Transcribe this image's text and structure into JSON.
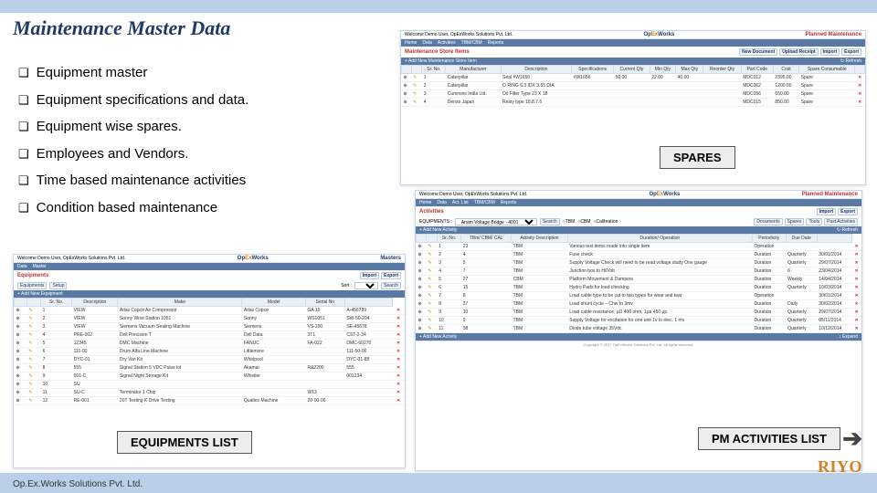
{
  "slide": {
    "title": "Maintenance Master Data",
    "footer": "Op.Ex.Works Solutions Pvt. Ltd.",
    "brand": "RIYO"
  },
  "bullets": [
    "Equipment master",
    "Equipment specifications and data.",
    "Equipment wise spares.",
    "Employees and Vendors.",
    "Time based maintenance activities",
    "Condition based maintenance"
  ],
  "labels": {
    "spares": "SPARES",
    "equip": "EQUIPMENTS LIST",
    "pm": "PM ACTIVITIES LIST"
  },
  "app": {
    "welcome": "Welcome Demo User, OpExWorks Solutions Pvt. Ltd.",
    "logo_a": "Op",
    "logo_b": "Ex",
    "logo_c": "Works",
    "pm_label": "Planned Maintenance",
    "masters_label": "Masters",
    "nav": [
      "Home",
      "Data",
      "Activities",
      "TBM/CBM",
      "Reports"
    ],
    "nav2": [
      "Data",
      "Master"
    ],
    "nav3": [
      "Home",
      "Data",
      "Act. List",
      "TBM/CBM",
      "Reports"
    ],
    "copyright": "Copyright © 2017 OpExWorks Solutions Pvt. Ltd. All rights reserved."
  },
  "spares": {
    "heading": "Maintenance Store Items",
    "buttons": [
      "New Document",
      "Upload Receipt",
      "Import",
      "Export"
    ],
    "bar_add": "+ Add New Maintenance Store Item",
    "refresh": "↻ Refresh",
    "cols": [
      "",
      "",
      "Sr. No.",
      "Manufacturer",
      "Description",
      "Specifications",
      "Current Qty",
      "Min Qty",
      "Max Qty",
      "Reorder Qty",
      "Part Code",
      "Cost",
      "Spare Consumable",
      ""
    ],
    "rows": [
      [
        "1",
        "Caterpillar",
        "Seal #W1656",
        "#W1656",
        "50.00",
        "22.00",
        "40.00",
        "",
        "MDC012",
        "2395.00",
        "Spare"
      ],
      [
        "2",
        "Caterpillar",
        "O RING 6.3 IDX 3.55 DIA",
        "",
        "",
        "",
        "",
        "",
        "MDC062",
        "1200.00",
        "Spare"
      ],
      [
        "3",
        "Cummins India Ltd.",
        "Oil Filter Type 23 X 18",
        "",
        "",
        "",
        "",
        "",
        "MDC056",
        "650.00",
        "Spare"
      ],
      [
        "4",
        "Denso Japan",
        "Relay type 18.8.7.6",
        "",
        "",
        "",
        "",
        "",
        "MDC015",
        "850.00",
        "Spare"
      ]
    ]
  },
  "equip": {
    "heading": "Equipments",
    "tabs": [
      "Equipments",
      "Setup"
    ],
    "sort": "Sort :",
    "buttons": [
      "Import",
      "Export"
    ],
    "search": "Search",
    "bar_add": "+ Add New Equipment",
    "cols": [
      "",
      "",
      "Sr. No.",
      "Description",
      "Make",
      "Model",
      "Serial No",
      ""
    ],
    "rows": [
      [
        "1",
        "VIEW",
        "Atlas Copco Air Compressor",
        "Atlas Copco",
        "GA 15",
        "A-456789"
      ],
      [
        "2",
        "VIEW",
        "Sunny Wrist Station 1051",
        "Sunny",
        "WS1051",
        "SW-50-204"
      ],
      [
        "3",
        "VIEW",
        "Siemens Vacuum Sealing Machine",
        "Siemens",
        "VS-200",
        "SE-45678"
      ],
      [
        "4",
        "PRE-002",
        "Dell Precision T",
        "Dell Data",
        "3T1",
        "CST-2-34"
      ],
      [
        "5",
        "12345",
        "DMC Machine",
        "FANUC",
        "FA-022",
        "DMC-60270"
      ],
      [
        "6",
        "111-00",
        "Drum Alfa Line Machine",
        "Littlemore",
        "",
        "111-50-00"
      ],
      [
        "7",
        "DYC-01",
        "Dry Van Kit",
        "Whirlpool",
        "",
        "DYC-01-88"
      ],
      [
        "8",
        "555",
        "Signal Station 5 VDC Pulse kit",
        "Akamai",
        "R&2200",
        "555"
      ],
      [
        "9",
        "001-C",
        "Signal Night Storage Kit",
        "Whistler",
        "",
        "001234"
      ],
      [
        "10",
        "SU",
        "",
        "",
        "",
        ""
      ],
      [
        "11",
        "SU-C",
        "Terminator 1 Chip",
        "",
        "W13",
        ""
      ],
      [
        "12",
        "RE-001",
        "20T Testing K Drive Testing",
        "Qualtex Machine",
        "20-00-09",
        ""
      ]
    ]
  },
  "acts": {
    "heading": "Activities",
    "buttons": [
      "Import",
      "Export"
    ],
    "filter_label": "EQUIPMENTS :",
    "filter_value": "Anam Voltage Bridge - 4001",
    "radios": [
      "TBM",
      "CBM",
      "Calibration"
    ],
    "search": "Search",
    "pills": [
      "Documents",
      "Spares",
      "Tools",
      "Past Activities"
    ],
    "bar_add": "+ Add New Activity",
    "refresh": "↻ Refresh",
    "cols": [
      "",
      "",
      "Sr. No.",
      "TBm/ CBM/ CAL",
      "Activity Description",
      "Duration/ Operation",
      "Periodicity",
      "Due Date",
      ""
    ],
    "rows": [
      [
        "1",
        "23",
        "TBM",
        "Various test items made into single item",
        "Operation",
        "",
        ""
      ],
      [
        "2",
        "4",
        "TBM",
        "Fuse check",
        "Duration",
        "Quarterly",
        "30/01/2014"
      ],
      [
        "3",
        "5",
        "TBM",
        "Supply Voltage Check will need to be read voltage study One gauge",
        "Duration",
        "Quarterly",
        "29/07/2014"
      ],
      [
        "4",
        "7",
        "TBM",
        "Junction box to Hi/Volt",
        "Duration",
        "6",
        "23/04/2014"
      ],
      [
        "5",
        "27",
        "CBM",
        "Platform Movement & Dampers",
        "Duration",
        "Weekly",
        "14/04/2014"
      ],
      [
        "6",
        "15",
        "TBM",
        "Hydro Pads for load checking",
        "Duration",
        "Quarterly",
        "10/03/2014"
      ],
      [
        "7",
        "8",
        "TBM",
        "Load cable type to be cut to two types for wear and tear",
        "Operation",
        "",
        "30/01/2014"
      ],
      [
        "8",
        "37",
        "TBM",
        "Load shunt cycle – Chw to 3mv",
        "Duration",
        "Daily",
        "30/02/2014"
      ],
      [
        "9",
        "10",
        "TBM",
        "Load cable resistance, μΩ 400 ohm, 1μa 450 μp",
        "Duration",
        "Quarterly",
        "29/07/2014"
      ],
      [
        "10",
        "9",
        "TBM",
        "Supply Voltage for excitation for one unit 1v to elec. 1 mv",
        "Duration",
        "Quarterly",
        "05/11/2014"
      ],
      [
        "11",
        "38",
        "TBM",
        "Diode tube voltage 35Vdc",
        "Duration",
        "Quarterly",
        "10/12/2014"
      ]
    ],
    "expand": "↕ Expand"
  }
}
